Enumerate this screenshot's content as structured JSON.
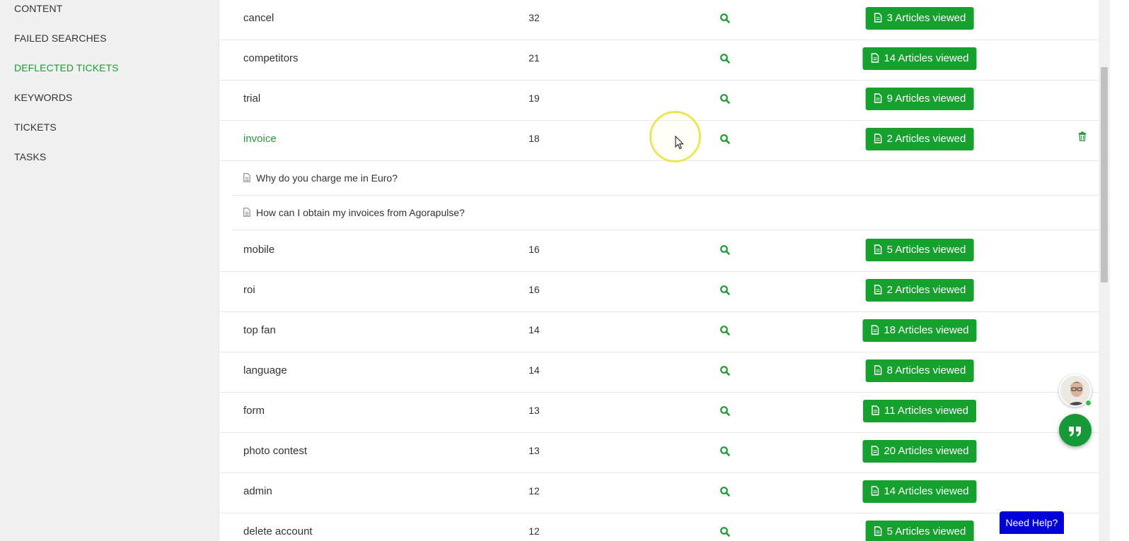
{
  "sidebar": {
    "items": [
      {
        "label": "CONTENT"
      },
      {
        "label": "FAILED SEARCHES"
      },
      {
        "label": "DEFLECTED TICKETS",
        "active": true
      },
      {
        "label": "KEYWORDS"
      },
      {
        "label": "TICKETS"
      },
      {
        "label": "TASKS"
      }
    ]
  },
  "keywords": [
    {
      "keyword": "cancel",
      "count": "32",
      "button": "3 Articles viewed"
    },
    {
      "keyword": "competitors",
      "count": "21",
      "button": "14 Articles viewed"
    },
    {
      "keyword": "trial",
      "count": "19",
      "button": "9 Articles viewed"
    },
    {
      "keyword": "invoice",
      "count": "18",
      "button": "2 Articles viewed",
      "expanded": true,
      "articles": [
        "Why do you charge me in Euro?",
        "How can I obtain my invoices from Agorapulse?"
      ]
    },
    {
      "keyword": "mobile",
      "count": "16",
      "button": "5 Articles viewed"
    },
    {
      "keyword": "roi",
      "count": "16",
      "button": "2 Articles viewed"
    },
    {
      "keyword": "top fan",
      "count": "14",
      "button": "18 Articles viewed"
    },
    {
      "keyword": "language",
      "count": "14",
      "button": "8 Articles viewed"
    },
    {
      "keyword": "form",
      "count": "13",
      "button": "11 Articles viewed"
    },
    {
      "keyword": "photo contest",
      "count": "13",
      "button": "20 Articles viewed"
    },
    {
      "keyword": "admin",
      "count": "12",
      "button": "14 Articles viewed"
    },
    {
      "keyword": "delete account",
      "count": "12",
      "button": "5 Articles viewed"
    }
  ],
  "help": {
    "label": "Need Help?"
  },
  "colors": {
    "accent": "#16a02e",
    "link": "#2a9a3c",
    "help_button": "#0000d8"
  }
}
